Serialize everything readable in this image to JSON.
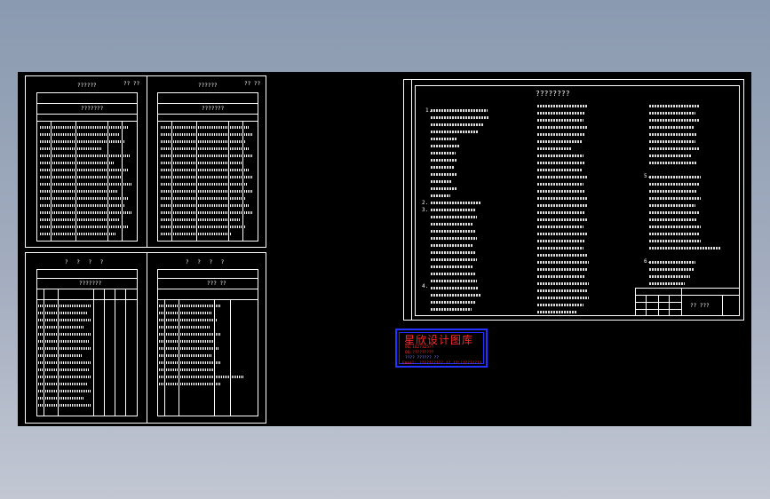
{
  "sheets": {
    "top_left_a": {
      "title": "??????",
      "code": "?? ??",
      "sub": "???????"
    },
    "top_left_b": {
      "title": "??????",
      "code": "?? ??",
      "sub": "???????"
    },
    "bottom_left_a": {
      "title": "? ? ? ?",
      "sub": "???????"
    },
    "bottom_left_b": {
      "title": "? ? ? ?",
      "sub": "??? ??"
    }
  },
  "notes_sheet": {
    "title": "????????",
    "section_markers": [
      "1.",
      "2.",
      "3.",
      "4.",
      "5.",
      "6."
    ],
    "title_block_sub": "?? ???"
  },
  "stamp": {
    "title": "星欣设计图库",
    "line1": "QQ:1627325??",
    "line2": "QQ:?????????",
    "line3": "????  ??????  ??",
    "line4": "Email: ??????????.??   ??:?????????"
  }
}
